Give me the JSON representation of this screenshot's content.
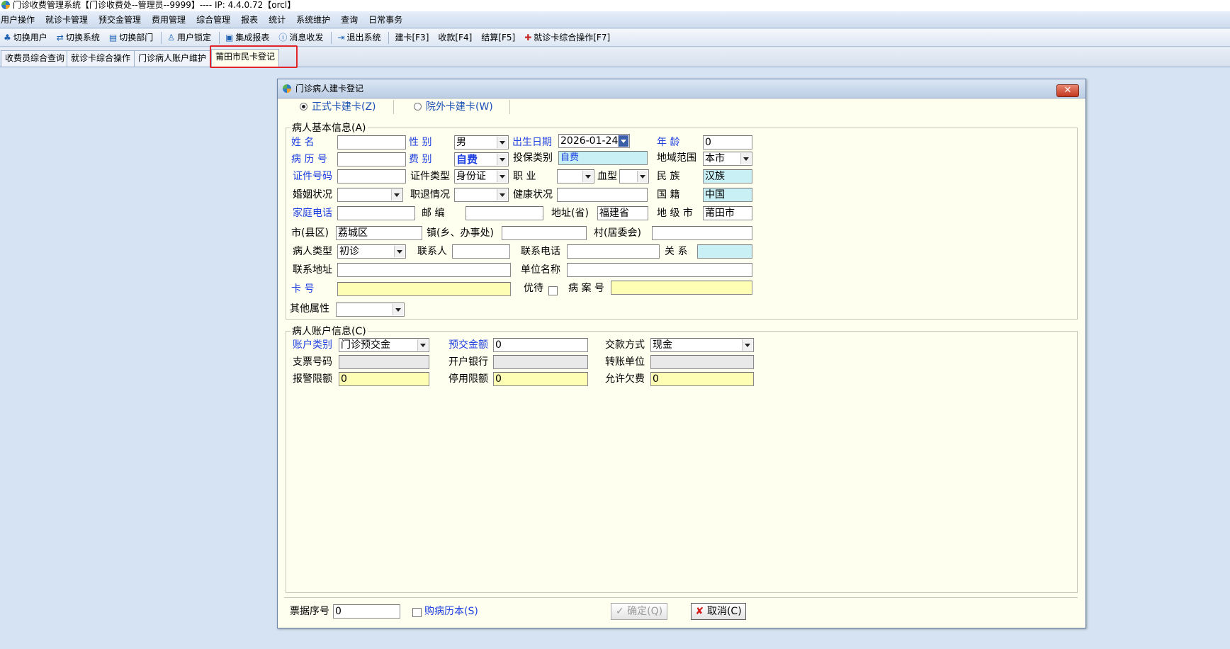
{
  "window": {
    "title": "门诊收费管理系统【门诊收费处--管理员--9999】---- IP:  4.4.0.72【orcl】"
  },
  "menubar": [
    "用户操作",
    "就诊卡管理",
    "预交金管理",
    "费用管理",
    "综合管理",
    "报表",
    "统计",
    "系统维护",
    "查询",
    "日常事务"
  ],
  "toolbar": {
    "switch_user": "切换用户",
    "switch_system": "切换系统",
    "switch_dept": "切换部门",
    "lock_user": "用户锁定",
    "integrated_report": "集成报表",
    "message": "消息收发",
    "exit": "退出系统",
    "build_card": "建卡[F3]",
    "charge": "收款[F4]",
    "settle": "结算[F5]",
    "card_ops": "就诊卡综合操作[F7]"
  },
  "tabs": [
    "收费员综合查询",
    "就诊卡综合操作",
    "门诊病人账户维护",
    "莆田市民卡登记"
  ],
  "dialog": {
    "title": "门诊病人建卡登记",
    "close": "✕",
    "radio_formal": "正式卡建卡(Z)",
    "radio_external": "院外卡建卡(W)",
    "basic": {
      "legend": "病人基本信息(A)",
      "name_label": "姓    名",
      "name_value": "",
      "gender_label": "性    别",
      "gender_value": "男",
      "birth_label": "出生日期",
      "birth_value": "2026-01-24",
      "age_label": "年    龄",
      "age_value": "0",
      "record_label": "病 历 号",
      "record_value": "",
      "fee_label": "费    别",
      "fee_value": "自费",
      "insure_label": "投保类别",
      "insure_value": "自费",
      "region_label": "地域范围",
      "region_value": "本市",
      "id_label": "证件号码",
      "id_value": "",
      "id_type_label": "证件类型",
      "id_type_value": "身份证",
      "job_label": "职    业",
      "job_value": "",
      "blood_label": "血型",
      "blood_value": "",
      "ethnic_label": "民    族",
      "ethnic_value": "汉族",
      "marital_label": "婚姻状况",
      "marital_value": "",
      "retire_label": "职退情况",
      "retire_value": "",
      "health_label": "健康状况",
      "health_value": "",
      "nation_label": "国    籍",
      "nation_value": "中国",
      "phone_label": "家庭电话",
      "phone_value": "",
      "zip_label": "邮    编",
      "zip_value": "",
      "province_label": "地址(省)",
      "province_value": "福建省",
      "city_label": "地 级 市",
      "city_value": "莆田市",
      "county_label": "市(县区)",
      "county_value": "荔城区",
      "town_label": "镇(乡、办事处)",
      "town_value": "",
      "village_label": "村(居委会)",
      "village_value": "",
      "ptype_label": "病人类型",
      "ptype_value": "初诊",
      "contact_label": "联系人",
      "contact_value": "",
      "cphone_label": "联系电话",
      "cphone_value": "",
      "relation_label": "关    系",
      "relation_value": "",
      "caddr_label": "联系地址",
      "caddr_value": "",
      "unit_label": "单位名称",
      "unit_value": "",
      "card_label": "卡      号",
      "card_value": "",
      "vip_label": "优待",
      "case_label": "病 案 号",
      "case_value": "",
      "other_label": "其他属性",
      "other_value": ""
    },
    "account": {
      "legend": "病人账户信息(C)",
      "acct_type_label": "账户类别",
      "acct_type_value": "门诊预交金",
      "prepay_label": "预交金额",
      "prepay_value": "0",
      "pay_method_label": "交款方式",
      "pay_method_value": "现金",
      "cheque_label": "支票号码",
      "cheque_value": "",
      "bank_label": "开户银行",
      "bank_value": "",
      "transfer_label": "转账单位",
      "transfer_value": "",
      "alarm_label": "报警限额",
      "alarm_value": "0",
      "stop_label": "停用限额",
      "stop_value": "0",
      "overdraft_label": "允许欠费",
      "overdraft_value": "0"
    },
    "footer": {
      "receipt_label": "票据序号",
      "receipt_value": "0",
      "buy_record_label": "购病历本(S)",
      "confirm_label": "确定(Q)",
      "cancel_label": "取消(C)"
    }
  },
  "colors": {
    "blue_label": "#1d3fe0",
    "cyan_field": "#c8f0f5",
    "yellow_field": "#fefeb4",
    "highlight": "#e3242b"
  }
}
